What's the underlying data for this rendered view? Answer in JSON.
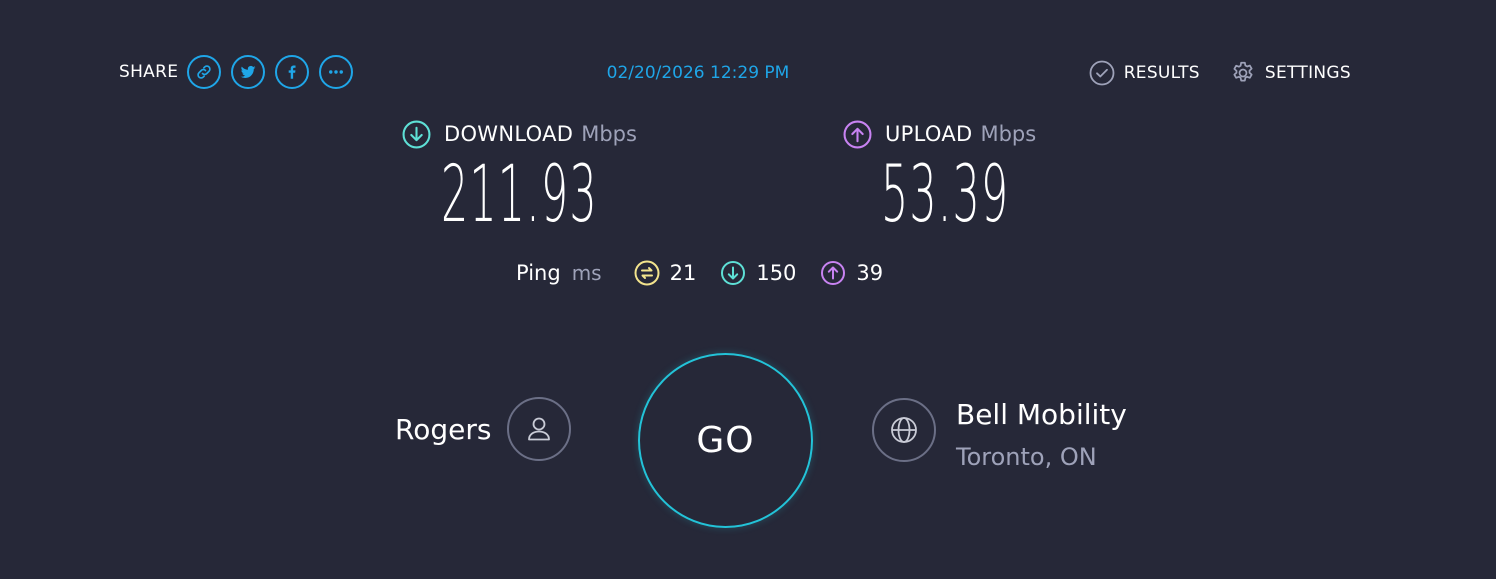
{
  "header": {
    "share_label": "SHARE",
    "share_buttons": [
      "link-icon",
      "twitter-icon",
      "facebook-icon",
      "more-icon"
    ],
    "timestamp": "02/20/2026 12:29 PM",
    "nav": {
      "results": "RESULTS",
      "settings": "SETTINGS"
    }
  },
  "download": {
    "title": "DOWNLOAD",
    "unit": "Mbps",
    "value": "211.93",
    "color": "#5ee0d6"
  },
  "upload": {
    "title": "UPLOAD",
    "unit": "Mbps",
    "value": "53.39",
    "color": "#c883f2"
  },
  "ping": {
    "label": "Ping",
    "unit": "ms",
    "idle": "21",
    "download": "150",
    "upload": "39",
    "idle_color": "#f3e48d"
  },
  "isp": {
    "name": "Rogers"
  },
  "go": {
    "label": "GO",
    "color": "#23c3d8"
  },
  "server": {
    "name": "Bell Mobility",
    "location": "Toronto, ON"
  },
  "colors": {
    "background": "#262838",
    "accent": "#1fa6e8",
    "muted": "#9ea2b9"
  }
}
